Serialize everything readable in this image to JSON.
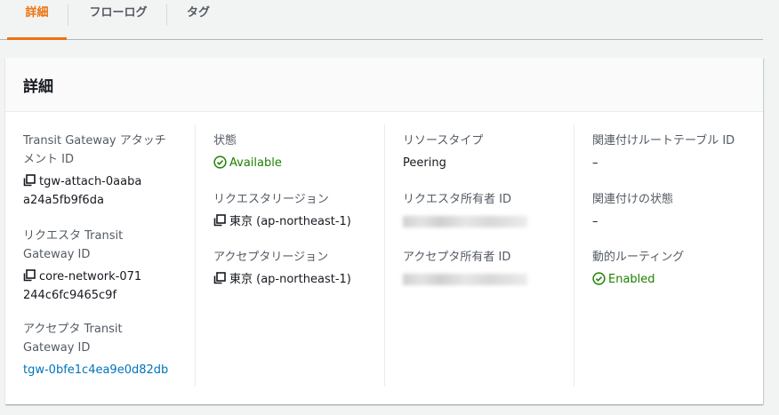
{
  "tabs": [
    {
      "label": "詳細",
      "active": true
    },
    {
      "label": "フローログ",
      "active": false
    },
    {
      "label": "タグ",
      "active": false
    }
  ],
  "panel": {
    "title": "詳細",
    "columns": [
      {
        "fields": [
          {
            "label": "Transit Gateway アタッチメント ID",
            "value": "tgw-attach-0aabaa24a5fb9f6da",
            "copyable": true
          },
          {
            "label": "リクエスタ Transit Gateway ID",
            "value": "core-network-071244c6fc9465c9f",
            "copyable": true
          },
          {
            "label": "アクセプタ Transit Gateway ID",
            "value": "tgw-0bfe1c4ea9e0d82db",
            "link": true
          }
        ]
      },
      {
        "fields": [
          {
            "label": "状態",
            "value": "Available",
            "status": "ok"
          },
          {
            "label": "リクエスタリージョン",
            "value": "東京 (ap-northeast-1)",
            "copyable": true
          },
          {
            "label": "アクセプタリージョン",
            "value": "東京 (ap-northeast-1)",
            "copyable": true
          }
        ]
      },
      {
        "fields": [
          {
            "label": "リソースタイプ",
            "value": "Peering"
          },
          {
            "label": "リクエスタ所有者 ID",
            "value": "",
            "redacted": true
          },
          {
            "label": "アクセプタ所有者 ID",
            "value": "",
            "redacted": true
          }
        ]
      },
      {
        "fields": [
          {
            "label": "関連付けルートテーブル ID",
            "value": "–"
          },
          {
            "label": "関連付けの状態",
            "value": "–"
          },
          {
            "label": "動的ルーティング",
            "value": "Enabled",
            "status": "ok"
          }
        ]
      }
    ]
  },
  "colors": {
    "accent": "#ec7211",
    "success": "#1d8102",
    "link": "#0073bb",
    "label": "#545b64"
  }
}
